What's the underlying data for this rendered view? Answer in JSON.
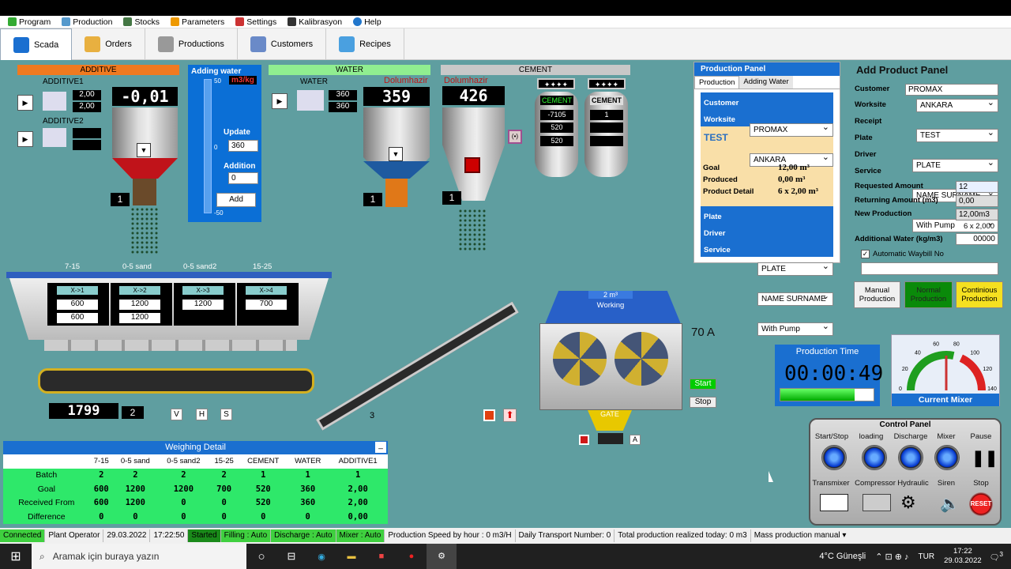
{
  "menu": [
    "Program",
    "Production",
    "Stocks",
    "Parameters",
    "Settings",
    "Kalibrasyon",
    "Help"
  ],
  "toolbar": [
    "Scada",
    "Orders",
    "Productions",
    "Customers",
    "Recipes"
  ],
  "additive": {
    "header": "ADDITIVE",
    "additive1_label": "ADDITIVE1",
    "a1_v1": "2,00",
    "a1_v2": "2,00",
    "additive2_label": "ADDITIVE2",
    "scale": "-0,01",
    "count": "1"
  },
  "adding_water": {
    "title": "Adding water",
    "unit": "m3/kg",
    "scale_top": "50",
    "scale_mid": "0",
    "scale_bottom": "-50",
    "update_label": "Update",
    "update_value": "360",
    "addition_label": "Addition",
    "addition_value": "0",
    "add_button": "Add"
  },
  "water": {
    "header": "WATER",
    "label": "WATER",
    "status": "Dolumhazir",
    "v1": "360",
    "v2": "360",
    "scale": "359",
    "count": "1"
  },
  "cement": {
    "header": "CEMENT",
    "status": "Dolumhazir",
    "scale": "426",
    "count": "1",
    "silo1_label": "CEMENT",
    "silo1_v1": "-7105",
    "silo1_v2": "520",
    "silo1_v3": "520",
    "silo2_label": "CEMENT",
    "silo2_v1": "1",
    "stars": "✦✦✦✦"
  },
  "aggregates": {
    "labels": [
      "7-15",
      "0-5 sand",
      "0-5 sand2",
      "15-25"
    ],
    "bins": [
      {
        "tag": "X->1",
        "v1": "600",
        "v2": "600"
      },
      {
        "tag": "X->2",
        "v1": "1200",
        "v2": "1200"
      },
      {
        "tag": "X->3",
        "v1": "1200",
        "v2": ""
      },
      {
        "tag": "X->4",
        "v1": "700",
        "v2": ""
      }
    ],
    "scale": "1799",
    "count": "2",
    "btn_v": "V",
    "btn_h": "H",
    "btn_s": "S",
    "conveyor_count": "3"
  },
  "mixer": {
    "capacity": "2 m³",
    "state": "Working",
    "amps": "70 A",
    "gate": "GATE",
    "start": "Start",
    "stop": "Stop",
    "a_btn": "A"
  },
  "production_panel": {
    "title": "Production Panel",
    "tab1": "Production",
    "tab2": "Adding Water",
    "customer_label": "Customer",
    "customer": "PROMAX",
    "worksite_label": "Worksite",
    "worksite": "ANKARA",
    "recipe": "TEST",
    "goal_label": "Goal",
    "goal": "12,00 m³",
    "produced_label": "Produced",
    "produced": "0,00 m³",
    "detail_label": "Product Detail",
    "detail": "6 x 2,00 m³",
    "plate_label": "Plate",
    "plate": "PLATE",
    "driver_label": "Driver",
    "driver": "NAME SURNAME",
    "service_label": "Service",
    "service": "With Pump"
  },
  "add_product": {
    "title": "Add Product Panel",
    "customer_label": "Customer",
    "customer": "PROMAX",
    "worksite_label": "Worksite",
    "worksite": "ANKARA",
    "receipt_label": "Receipt",
    "receipt": "TEST",
    "plate_label": "Plate",
    "plate": "PLATE",
    "driver_label": "Driver",
    "driver": "NAME SURNAME",
    "service_label": "Service",
    "service": "With Pump",
    "requested_label": "Requested Amount",
    "requested": "12",
    "returning_label": "Returning Amount (m3)",
    "returning": "0,00",
    "new_label": "New Production",
    "new_prod": "12,00m3",
    "calc": "6 x 2,000",
    "addwater_label": "Additional Water (kg/m3)",
    "addwater": "00000",
    "waybill": "Automatic Waybill No",
    "manual": "Manual Production",
    "normal": "Normal Production",
    "continuous": "Continious Production"
  },
  "production_time": {
    "title": "Production Time",
    "value": "00:00:49",
    "progress": 0.8
  },
  "gauge": {
    "title": "Current Mixer",
    "ticks": [
      "0",
      "20",
      "40",
      "60",
      "80",
      "100",
      "120",
      "140"
    ],
    "value": 70
  },
  "control_panel": {
    "title": "Control Panel",
    "row1": [
      "Start/Stop",
      "loading",
      "Discharge",
      "Mixer",
      "Pause"
    ],
    "row2": [
      "Transmixer",
      "Compressor",
      "Hydraulic",
      "Siren",
      "Stop"
    ],
    "reset": "RESET"
  },
  "weighing": {
    "title": "Weighing Detail",
    "cols": [
      "",
      "7-15",
      "0-5 sand",
      "0-5 sand2",
      "15-25",
      "CEMENT",
      "WATER",
      "ADDITIVE1"
    ],
    "rows": [
      [
        "Batch",
        "2",
        "2",
        "2",
        "2",
        "1",
        "1",
        "1"
      ],
      [
        "Goal",
        "600",
        "1200",
        "1200",
        "700",
        "520",
        "360",
        "2,00"
      ],
      [
        "Received From",
        "600",
        "1200",
        "0",
        "0",
        "520",
        "360",
        "2,00"
      ],
      [
        "Difference",
        "0",
        "0",
        "0",
        "0",
        "0",
        "0",
        "0,00"
      ]
    ]
  },
  "status": {
    "connected": "Connected",
    "operator": "Plant Operator",
    "date": "29.03.2022",
    "time": "17:22:50",
    "started": "Started",
    "filling": "Filling : Auto",
    "discharge": "Discharge : Auto",
    "mixer": "Mixer : Auto",
    "speed": "Production Speed by hour : 0 m3/H",
    "transport": "Daily Transport Number: 0",
    "total": "Total production realized today: 0 m3",
    "mass": "Mass production manual"
  },
  "taskbar": {
    "search": "Aramak için buraya yazın",
    "weather": "4°C  Güneşli",
    "lang": "TUR",
    "clock": "17:22",
    "date": "29.03.2022",
    "notif": "3"
  }
}
